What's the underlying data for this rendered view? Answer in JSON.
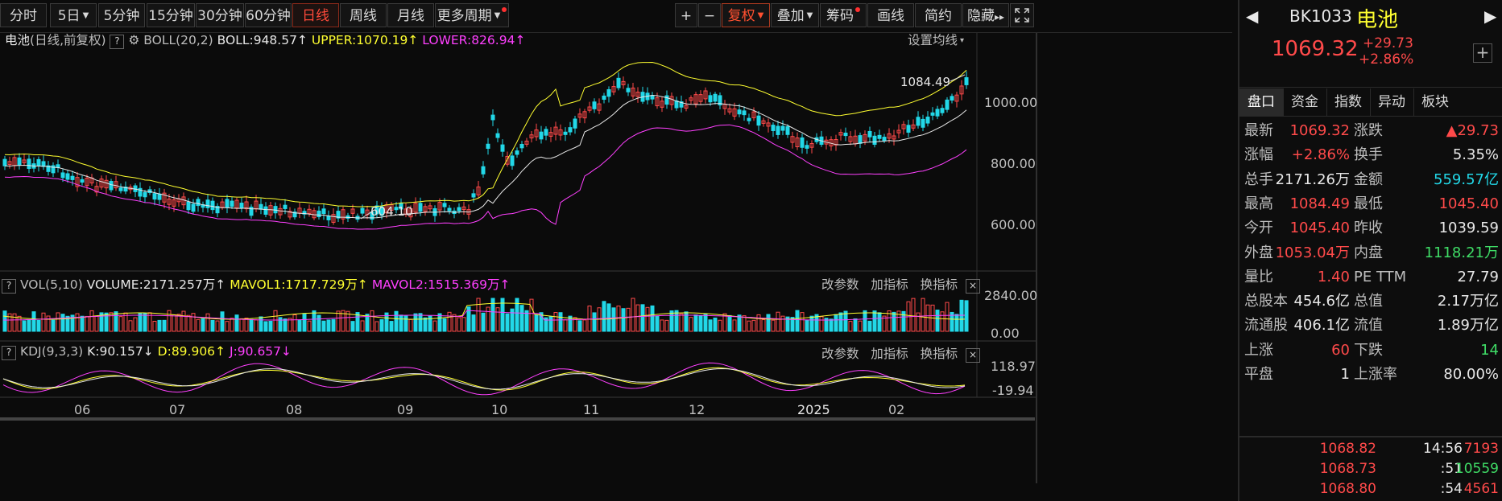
{
  "toolbar": {
    "periods": [
      "分时",
      "5日",
      "5分钟",
      "15分钟",
      "30分钟",
      "60分钟",
      "日线",
      "周线",
      "月线",
      "更多周期"
    ],
    "active_period": "日线",
    "plus": "+",
    "minus": "−",
    "adjust": "复权",
    "overlay": "叠加",
    "chips": "筹码",
    "draw": "画线",
    "simple": "简约",
    "hide": "隐藏"
  },
  "main": {
    "name": "电池",
    "mode": "(日线,前复权)",
    "help": "?",
    "indicator": "BOLL(20,2)",
    "boll": "BOLL:948.57",
    "upper": "UPPER:1070.19",
    "lower": "LOWER:826.94",
    "ma_setting": "设置均线",
    "y_ticks": [
      "1000.00",
      "800.00",
      "600.00"
    ],
    "high_label": "1084.49",
    "low_label": "604.10"
  },
  "vol": {
    "help": "?",
    "title": "VOL(5,10)",
    "volume": "VOLUME:2171.257万",
    "mavol1": "MAVOL1:1717.729万",
    "mavol2": "MAVOL2:1515.369万",
    "edit": "改参数",
    "add": "加指标",
    "switch": "换指标",
    "y_ticks": [
      "2840.00",
      "0.00"
    ]
  },
  "kdj": {
    "help": "?",
    "title": "KDJ(9,3,3)",
    "k": "K:90.157",
    "d": "D:89.906",
    "j": "J:90.657",
    "edit": "改参数",
    "add": "加指标",
    "switch": "换指标",
    "y_ticks": [
      "118.97",
      "-19.94"
    ]
  },
  "x_axis": [
    "06",
    "07",
    "08",
    "09",
    "10",
    "11",
    "12",
    "2025",
    "02"
  ],
  "panel": {
    "code": "BK1033",
    "name": "电池",
    "price": "1069.32",
    "change": "+29.73",
    "change_pct": "+2.86%",
    "tabs": [
      "盘口",
      "资金",
      "指数",
      "异动",
      "板块"
    ],
    "rows": [
      [
        "最新",
        "1069.32",
        "涨跌",
        "▲29.73"
      ],
      [
        "涨幅",
        "+2.86%",
        "换手",
        "5.35%"
      ],
      [
        "总手",
        "2171.26万",
        "金额",
        "559.57亿"
      ],
      [
        "最高",
        "1084.49",
        "最低",
        "1045.40"
      ],
      [
        "今开",
        "1045.40",
        "昨收",
        "1039.59"
      ],
      [
        "外盘",
        "1053.04万",
        "内盘",
        "1118.21万"
      ],
      [
        "量比",
        "1.40",
        "PE TTM",
        "27.79"
      ],
      [
        "总股本",
        "454.6亿",
        "总值",
        "2.17万亿"
      ],
      [
        "流通股",
        "406.1亿",
        "流值",
        "1.89万亿"
      ],
      [
        "上涨",
        "60",
        "下跌",
        "14"
      ],
      [
        "平盘",
        "1",
        "上涨率",
        "80.00%"
      ]
    ],
    "ticks": [
      [
        "14:56",
        "1068.82",
        "7193"
      ],
      [
        ":51",
        "1068.73",
        "10559"
      ],
      [
        ":54",
        "1068.80",
        "4561"
      ]
    ]
  },
  "colors": {
    "up": "#ff4a4a",
    "down": "#22d8e8",
    "mid": "#e8e8e8",
    "upper": "#ffff30",
    "lower": "#ff40ff"
  }
}
